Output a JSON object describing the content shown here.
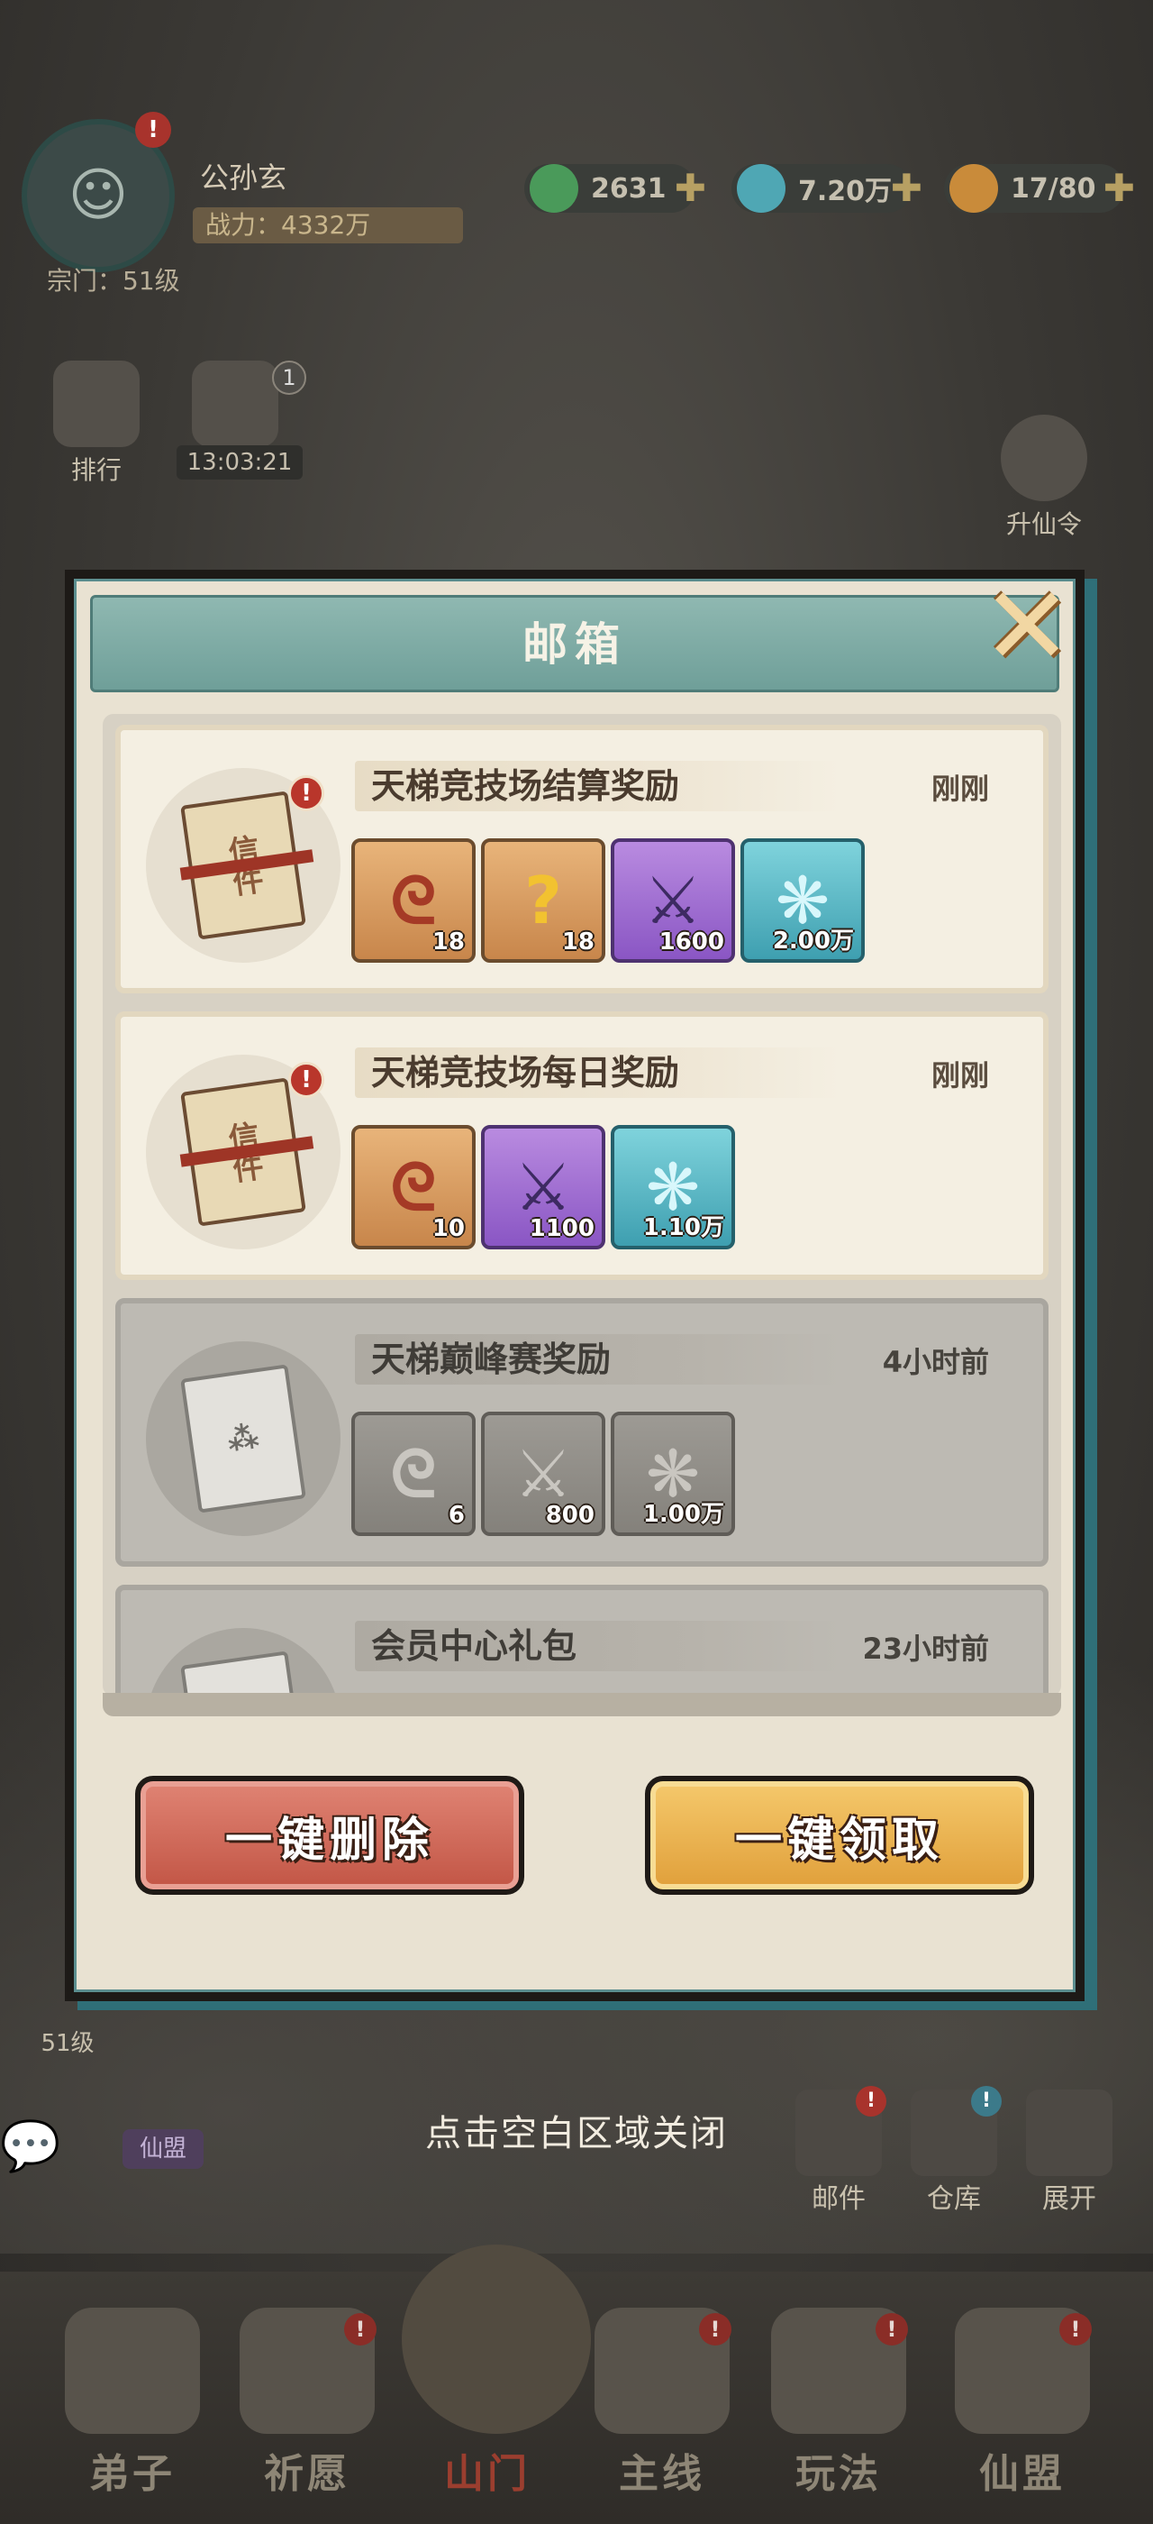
{
  "player": {
    "name": "公孙玄",
    "power": "战力：4332万",
    "sect": "宗门：51级",
    "avatar_badge": "!"
  },
  "resources": [
    {
      "icon": "jade-icon",
      "value": "2631",
      "color": "#4a9a5a"
    },
    {
      "icon": "crystal-icon",
      "value": "7.20万",
      "color": "#4fa7b4"
    },
    {
      "icon": "pouch-icon",
      "value": "17/80",
      "color": "#c98b3a"
    }
  ],
  "background": {
    "rank_label": "排行",
    "gift_timer": "13:03:21",
    "gift_count": "1",
    "ascend_label": "升仙令",
    "left_level": "51级",
    "close_hint": "点击空白区域关闭",
    "guild_pill": "仙盟",
    "right_buttons": [
      {
        "label": "邮件",
        "badge": "!"
      },
      {
        "label": "仓库",
        "badge": "!"
      },
      {
        "label": "展开",
        "badge": ""
      }
    ],
    "nav": [
      {
        "label": "弟子"
      },
      {
        "label": "祈愿",
        "badge": "!"
      },
      {
        "label": "山门"
      },
      {
        "label": "主线",
        "badge": "!"
      },
      {
        "label": "玩法",
        "badge": "!"
      },
      {
        "label": "仙盟",
        "badge": "!"
      }
    ]
  },
  "mailbox": {
    "title": "邮箱",
    "close_icon": "close-x-icon",
    "envelope_text": "信件",
    "mails": [
      {
        "title": "天梯竞技场结算奖励",
        "time": "刚刚",
        "read": false,
        "badge": "!",
        "rewards": [
          {
            "type": "scroll-ticket",
            "qty": "18",
            "color": "orange",
            "glyph": "ᘓ"
          },
          {
            "type": "mystery-chest",
            "qty": "18",
            "color": "orange",
            "glyph": "?"
          },
          {
            "type": "arena-medal",
            "qty": "1600",
            "color": "purple",
            "glyph": "⚔"
          },
          {
            "type": "spirit-crystal",
            "qty": "2.00万",
            "color": "blue",
            "glyph": "❋"
          }
        ]
      },
      {
        "title": "天梯竞技场每日奖励",
        "time": "刚刚",
        "read": false,
        "badge": "!",
        "rewards": [
          {
            "type": "scroll-ticket",
            "qty": "10",
            "color": "orange",
            "glyph": "ᘓ"
          },
          {
            "type": "arena-medal",
            "qty": "1100",
            "color": "purple",
            "glyph": "⚔"
          },
          {
            "type": "spirit-crystal",
            "qty": "1.10万",
            "color": "blue",
            "glyph": "❋"
          }
        ]
      },
      {
        "title": "天梯巅峰赛奖励",
        "time": "4小时前",
        "read": true,
        "badge": "",
        "rewards": [
          {
            "type": "scroll-ticket",
            "qty": "6",
            "color": "grey",
            "glyph": "ᘓ"
          },
          {
            "type": "arena-medal",
            "qty": "800",
            "color": "grey",
            "glyph": "⚔"
          },
          {
            "type": "spirit-crystal",
            "qty": "1.00万",
            "color": "grey",
            "glyph": "❋"
          }
        ]
      },
      {
        "title": "会员中心礼包",
        "time": "23小时前",
        "read": true,
        "badge": "",
        "rewards": [
          {
            "type": "reward-item",
            "qty": "",
            "color": "grey",
            "glyph": "⚙"
          }
        ]
      }
    ],
    "delete_all": "一键删除",
    "claim_all": "一键领取"
  }
}
